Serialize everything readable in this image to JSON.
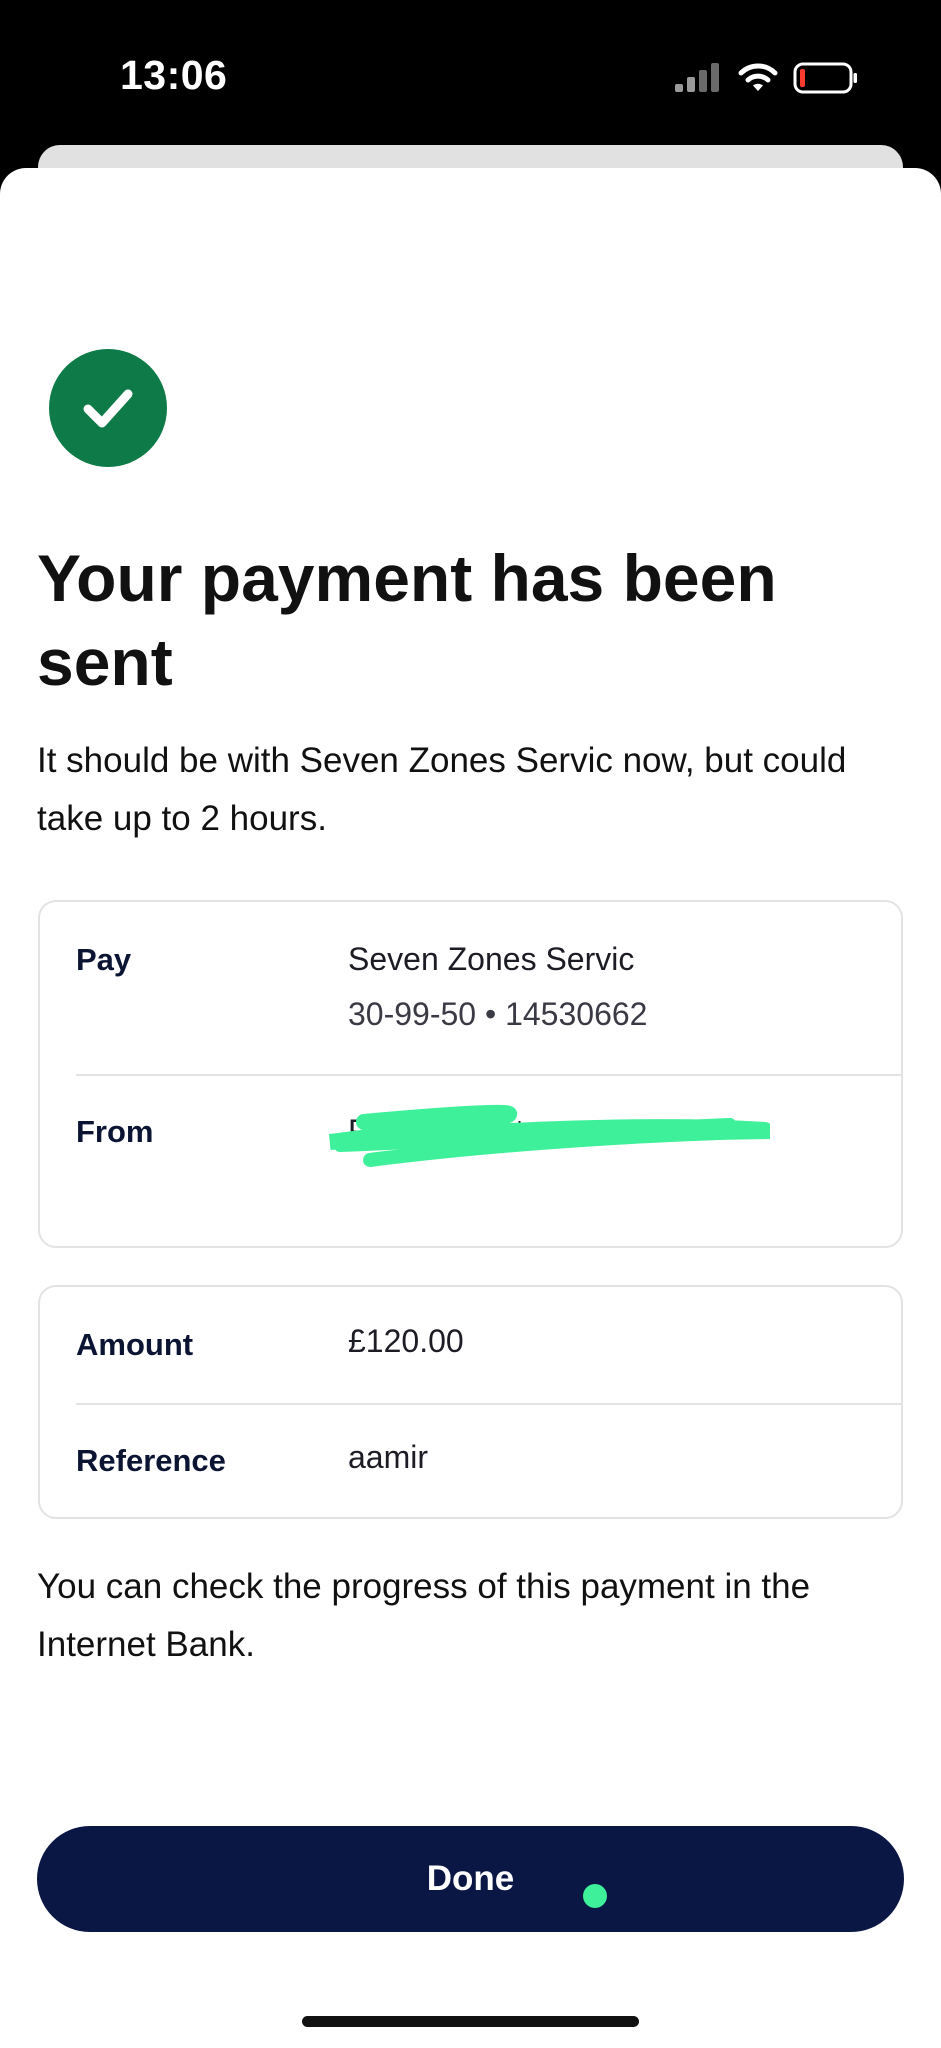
{
  "status_bar": {
    "time": "13:06",
    "icons": [
      "signal-icon",
      "wifi-icon",
      "battery-icon"
    ]
  },
  "success_icon": "checkmark-icon",
  "colors": {
    "success": "#0e7a48",
    "primary_button": "#0a1744",
    "redaction": "#3ef09a"
  },
  "title": "Your payment has been sent",
  "subtitle": "It should be with Seven Zones Servic now, but could take up to 2 hours.",
  "payment_details": {
    "pay": {
      "label": "Pay",
      "name": "Seven Zones Servic",
      "account": "30-99-50 • 14530662"
    },
    "from": {
      "label": "From",
      "name": "FlexAccount"
    }
  },
  "payment_summary": {
    "amount": {
      "label": "Amount",
      "value": "£120.00"
    },
    "reference": {
      "label": "Reference",
      "value": "aamir"
    }
  },
  "footer_text": "You can check the progress of this payment in the Internet Bank.",
  "done_button": {
    "label": "Done"
  }
}
